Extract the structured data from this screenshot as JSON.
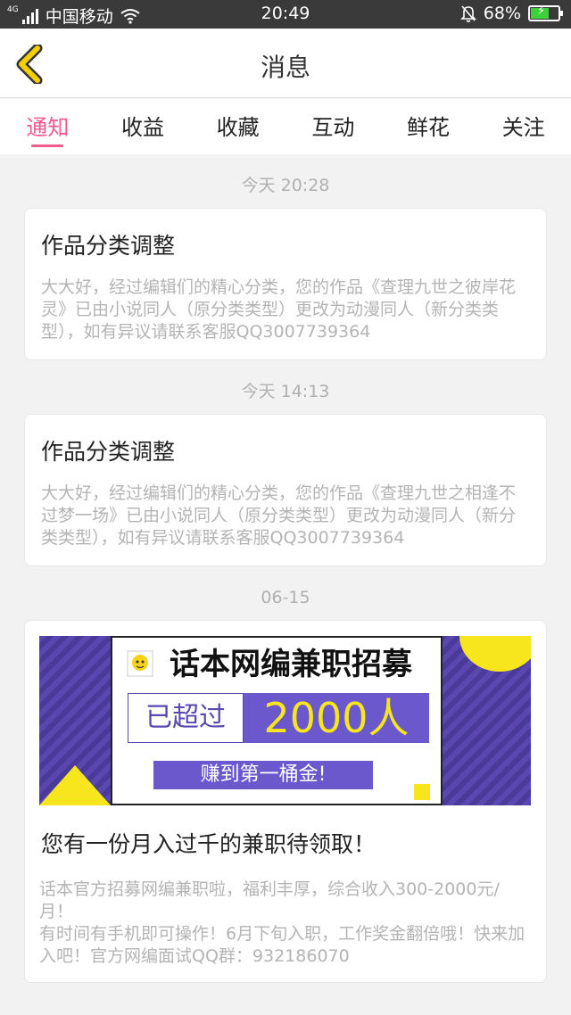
{
  "status_bar": {
    "network": "4G",
    "carrier": "中国移动",
    "time": "20:49",
    "battery": "68%",
    "battery_level": 0.68,
    "icons": [
      "signal-icon",
      "wifi-icon",
      "bell-muted-icon",
      "battery-charging-icon"
    ]
  },
  "header": {
    "title": "消息",
    "back_icon": "chevron-left-icon",
    "accent_color": "#f5d000"
  },
  "tabs": [
    {
      "label": "通知",
      "active": true
    },
    {
      "label": "收益",
      "active": false
    },
    {
      "label": "收藏",
      "active": false
    },
    {
      "label": "互动",
      "active": false
    },
    {
      "label": "鲜花",
      "active": false
    },
    {
      "label": "关注",
      "active": false
    }
  ],
  "active_tab_color": "#f05a8c",
  "messages": [
    {
      "time": "今天 20:28",
      "title": "作品分类调整",
      "body": "大大好，经过编辑们的精心分类，您的作品《查理九世之彼岸花灵》已由小说同人（原分类类型）更改为动漫同人（新分类类型），如有异议请联系客服QQ3007739364"
    },
    {
      "time": "今天 14:13",
      "title": "作品分类调整",
      "body": "大大好，经过编辑们的精心分类，您的作品《查理九世之相逢不过梦一场》已由小说同人（原分类类型）更改为动漫同人（新分类类型），如有异议请联系客服QQ3007739364"
    },
    {
      "time": "06-15",
      "banner": {
        "headline": "话本网编兼职招募",
        "box_left": "已超过",
        "box_right": "2000人",
        "cta": "赚到第一桶金!"
      },
      "title": "您有一份月入过千的兼职待领取！",
      "body_lines": [
        "话本官方招募网编兼职啦，福利丰厚，综合收入300-2000元/月！",
        "有时间有手机即可操作！6月下旬入职，工作奖金翻倍哦！快来加入吧！官方网编面试QQ群：932186070"
      ]
    }
  ]
}
